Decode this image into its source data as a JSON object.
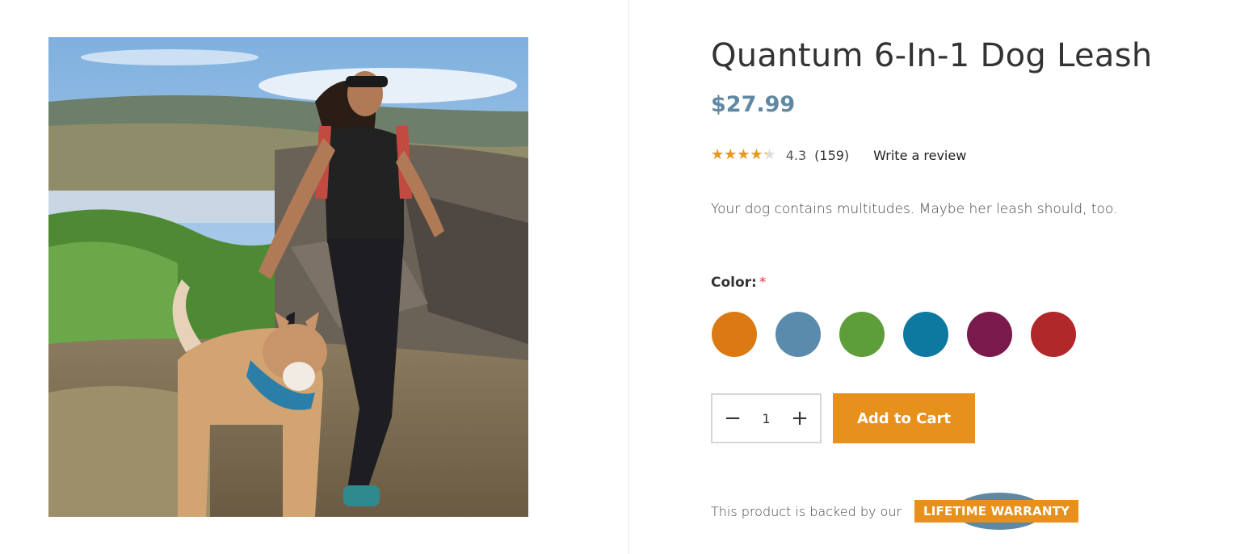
{
  "product": {
    "title": "Quantum 6-In-1 Dog Leash",
    "price": "$27.99",
    "image_alt": "woman-hiking-with-husky-photo"
  },
  "rating": {
    "stars": "★★★★★",
    "value": "4.3",
    "value_fraction": 0.86,
    "count": "(159)",
    "review_link": "Write a review"
  },
  "description": "Your dog contains multitudes. Maybe her leash should, too.",
  "color": {
    "label": "Color:",
    "required_mark": "*",
    "swatches": [
      {
        "name": "orange",
        "hex": "#db7a12"
      },
      {
        "name": "blue-gray",
        "hex": "#5a8bad"
      },
      {
        "name": "green",
        "hex": "#5e9e3a"
      },
      {
        "name": "teal-blue",
        "hex": "#0d78a0"
      },
      {
        "name": "plum",
        "hex": "#7a1a4c"
      },
      {
        "name": "red",
        "hex": "#b0282a"
      }
    ]
  },
  "quantity": {
    "minus": "−",
    "value": "1",
    "plus": "+"
  },
  "cart": {
    "add_label": "Add to Cart"
  },
  "warranty": {
    "text": "This product is backed by our",
    "badge": "LIFETIME WARRANTY"
  },
  "colors": {
    "accent": "#e8901c",
    "price": "#5f88a3",
    "star": "#e8981b"
  }
}
